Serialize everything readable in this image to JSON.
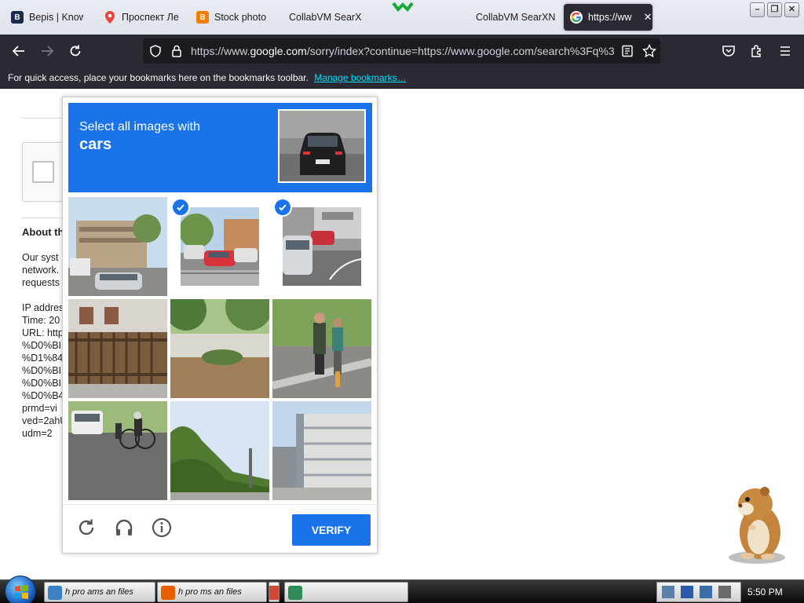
{
  "browser": {
    "tabs": [
      {
        "label": "Bepis | Know",
        "icon": "bepis-favicon"
      },
      {
        "label": "Проспект Ле",
        "icon": "maps-pin-icon"
      },
      {
        "label": "Stock photo",
        "icon": "blogger-icon"
      },
      {
        "label": "CollabVM SearX",
        "icon": "none"
      },
      {
        "label": "CollabVM SearXN",
        "icon": "none"
      },
      {
        "label": "https://ww",
        "icon": "google-icon",
        "active": true
      }
    ],
    "url": "https://www.google.com/sorry/index?continue=https://www.google.com/search%3Fq%3",
    "url_domain": "google.com",
    "bookmarks_bar": {
      "message": "For quick access, place your bookmarks here on the bookmarks toolbar.",
      "link": "Manage bookmarks…"
    }
  },
  "page_bg": {
    "heading": "About th",
    "paragraph": "Our syst\nnetwork.\nrequests",
    "details": "IP addres\nTime: 20\nURL: http\n%D0%BI\n%D1%84\n%D0%BI\n%D0%BI\n%D0%B4\nprmd=vi\nved=2ahU\nudm=2"
  },
  "captcha": {
    "instruction": "Select all images with",
    "target": "cars",
    "tiles": [
      {
        "scene": "street with buildings and cars",
        "selected": false
      },
      {
        "scene": "parked cars red car street",
        "selected": true
      },
      {
        "scene": "street cars red car",
        "selected": true
      },
      {
        "scene": "wooden fence",
        "selected": false
      },
      {
        "scene": "park path trees",
        "selected": false
      },
      {
        "scene": "pedestrians sidewalk",
        "selected": false
      },
      {
        "scene": "cyclist street van",
        "selected": false
      },
      {
        "scene": "trees road",
        "selected": false
      },
      {
        "scene": "modern building",
        "selected": false
      }
    ],
    "verify_label": "VERIFY",
    "accent": "#1a73e8"
  },
  "taskbar": {
    "clock": "5:50 PM",
    "items": [
      "h pro ams an files",
      "h pro ms an files",
      ""
    ]
  }
}
